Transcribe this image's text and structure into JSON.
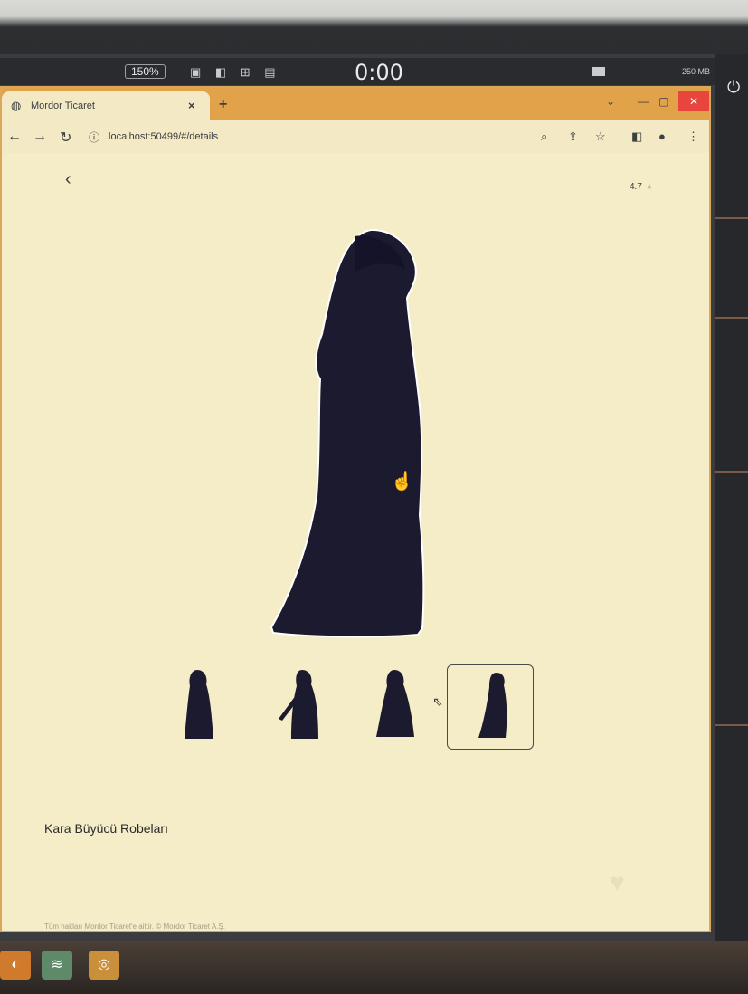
{
  "recorder": {
    "zoom_label": "150%",
    "timer": "0:00",
    "memory_label": "250 MB"
  },
  "browser": {
    "tab_title": "Mordor Ticaret",
    "tab_close": "×",
    "new_tab": "+",
    "url": "localhost:50499/#/details"
  },
  "page": {
    "back_icon": "chevron-left",
    "rating_value": "4.7",
    "product_name": "Kara Büyücü Robeları",
    "footer_text": "Tüm hakları Mordor Ticaret'e aittir. © Mordor Ticaret A.Ş.",
    "thumbnails": [
      {
        "label": "front view",
        "selected": false
      },
      {
        "label": "side view with staff",
        "selected": false
      },
      {
        "label": "back view",
        "selected": false
      },
      {
        "label": "profile view",
        "selected": true
      }
    ]
  },
  "colors": {
    "page_bg": "#f5ecc8",
    "tabstrip": "#e2a24a",
    "silhouette": "#1c1a2e",
    "close_red": "#e8453c"
  }
}
